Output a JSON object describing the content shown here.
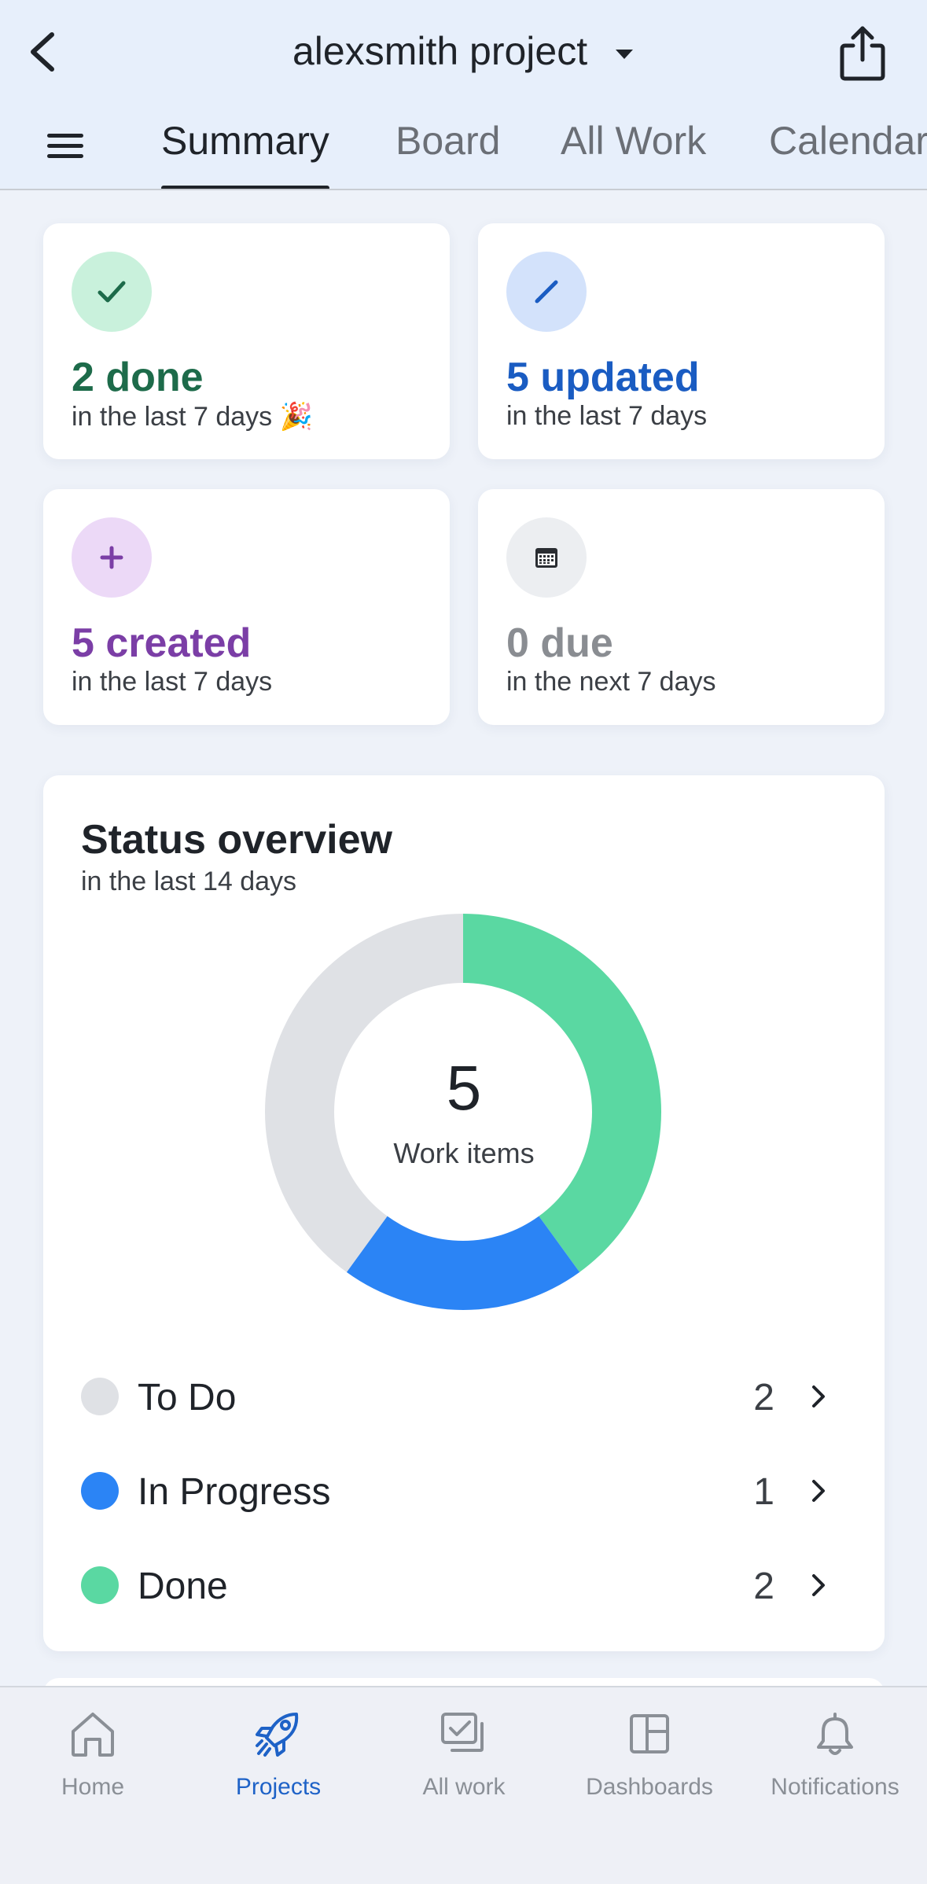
{
  "header": {
    "title": "alexsmith project",
    "tabs": [
      {
        "label": "Summary",
        "active": true
      },
      {
        "label": "Board",
        "active": false
      },
      {
        "label": "All Work",
        "active": false
      },
      {
        "label": "Calendar",
        "active": false
      }
    ]
  },
  "stats": [
    {
      "value": "2 done",
      "sub": "in the last 7 days 🎉",
      "icon": "check-icon",
      "color": "#1d6b4a",
      "bg": "#c9f1dc"
    },
    {
      "value": "5 updated",
      "sub": "in the last 7 days",
      "icon": "pencil-icon",
      "color": "#1a5cc2",
      "bg": "#d3e2fb"
    },
    {
      "value": "5 created",
      "sub": "in the last 7 days",
      "icon": "plus-icon",
      "color": "#7b3ea6",
      "bg": "#ecd9f7"
    },
    {
      "value": "0 due",
      "sub": "in the next 7 days",
      "icon": "calendar-icon",
      "color": "#8a8d92",
      "bg": "#eceef1"
    }
  ],
  "status_overview": {
    "title": "Status overview",
    "subtitle": "in the last 14 days",
    "total": "5",
    "total_label": "Work items",
    "items": [
      {
        "label": "To Do",
        "count": "2",
        "color": "#dfe1e5"
      },
      {
        "label": "In Progress",
        "count": "1",
        "color": "#2b84f5"
      },
      {
        "label": "Done",
        "count": "2",
        "color": "#5ad8a2"
      }
    ]
  },
  "chart_data": {
    "type": "pie",
    "categories": [
      "To Do",
      "In Progress",
      "Done"
    ],
    "values": [
      2,
      1,
      2
    ],
    "title": "Status overview"
  },
  "bottom_nav": [
    {
      "label": "Home",
      "icon": "home-icon",
      "active": false
    },
    {
      "label": "Projects",
      "icon": "rocket-icon",
      "active": true
    },
    {
      "label": "All work",
      "icon": "all-work-icon",
      "active": false
    },
    {
      "label": "Dashboards",
      "icon": "dashboard-icon",
      "active": false
    },
    {
      "label": "Notifications",
      "icon": "bell-icon",
      "active": false
    }
  ],
  "colors": {
    "accent": "#1e62c7",
    "header_bg": "#e7effb",
    "page_bg": "#eef2f9"
  }
}
